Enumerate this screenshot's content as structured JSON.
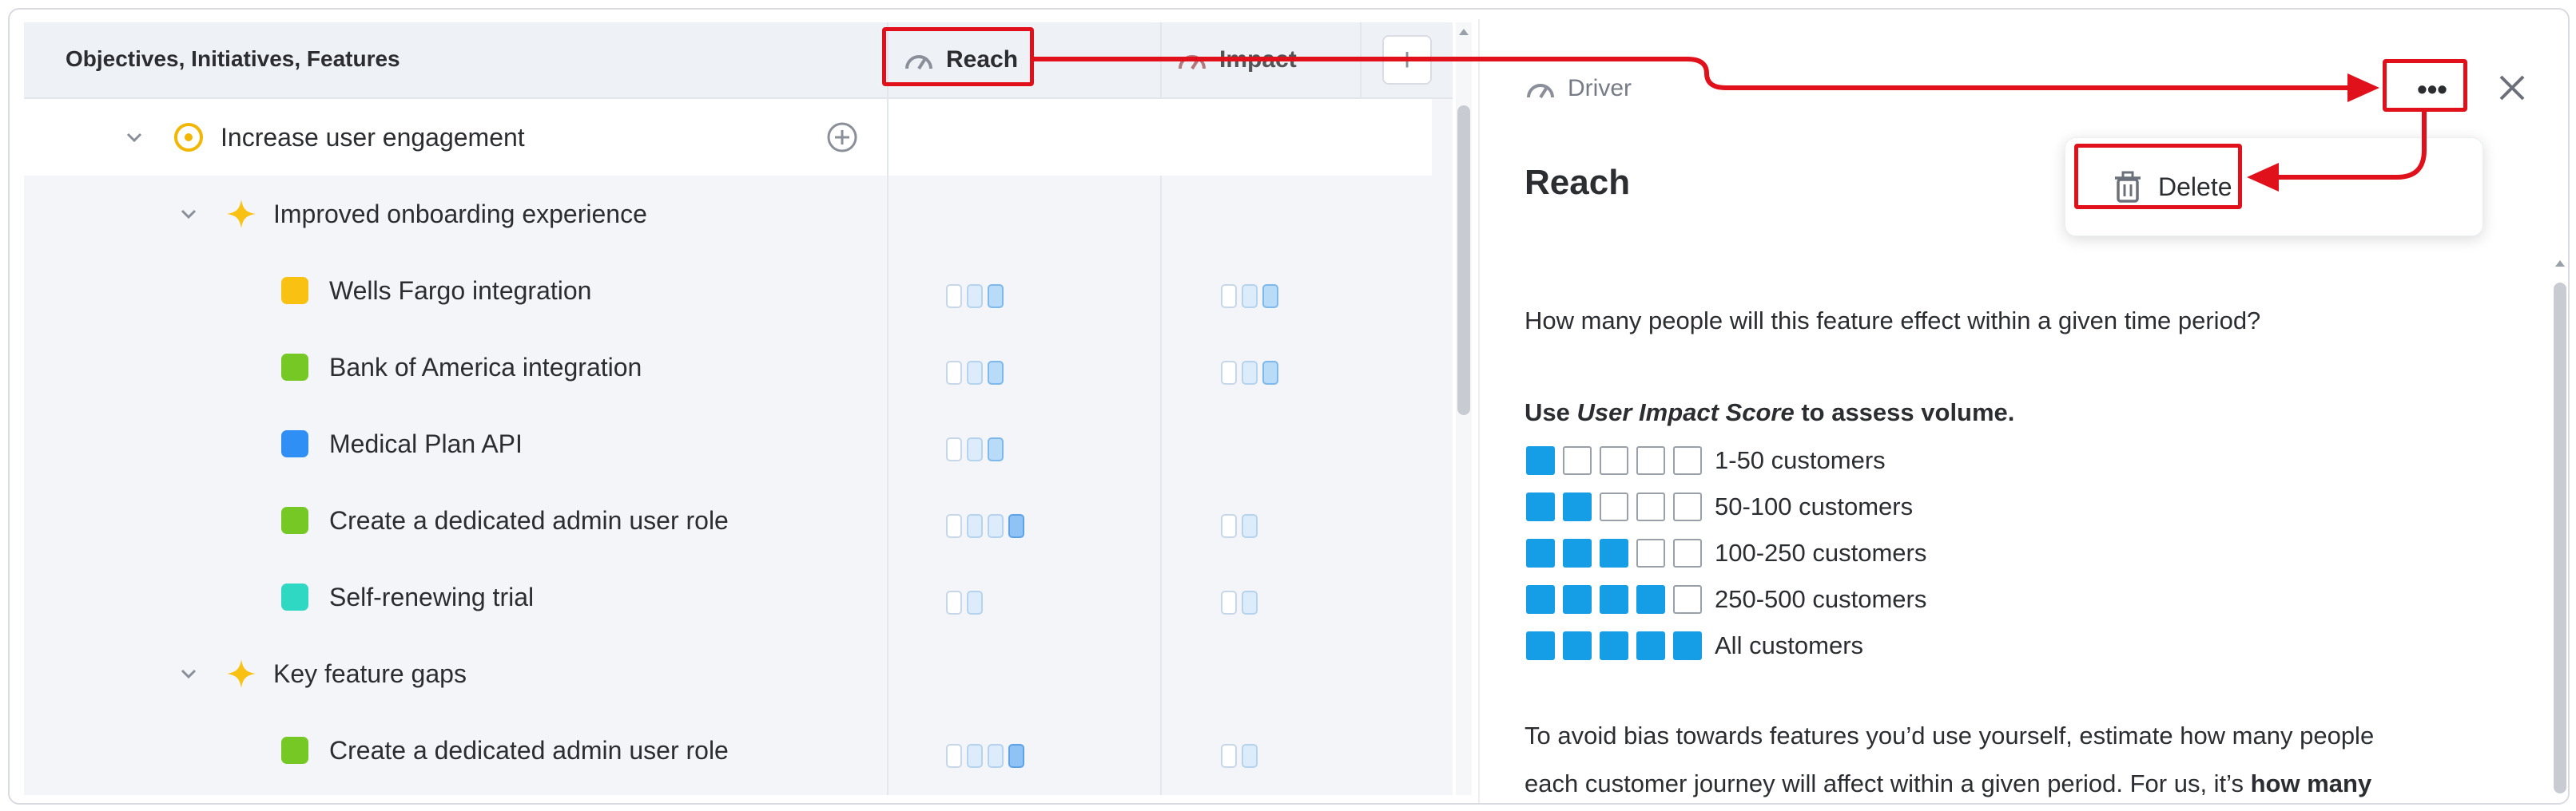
{
  "grid": {
    "header_title": "Objectives, Initiatives, Features",
    "columns": [
      {
        "label": "Reach",
        "icon": "gauge-icon"
      },
      {
        "label": "Impact",
        "icon": "gauge-icon"
      }
    ],
    "add_column_label": "+",
    "rows": [
      {
        "label": "Increase user engagement",
        "type": "objective"
      },
      {
        "label": "Improved onboarding experience",
        "type": "initiative"
      },
      {
        "label": "Wells Fargo integration",
        "type": "feature",
        "color": "#f9c112"
      },
      {
        "label": "Bank of America integration",
        "type": "feature",
        "color": "#76c924"
      },
      {
        "label": "Medical Plan API",
        "type": "feature",
        "color": "#2f8ff5"
      },
      {
        "label": "Create a dedicated admin user role",
        "type": "feature",
        "color": "#76c924"
      },
      {
        "label": "Self-renewing trial",
        "type": "feature",
        "color": "#2ed8c3"
      },
      {
        "label": "Key feature gaps",
        "type": "initiative"
      },
      {
        "label": "Create a dedicated admin user role",
        "type": "feature",
        "color": "#76c924"
      }
    ]
  },
  "panel": {
    "driver_label": "Driver",
    "title": "Reach",
    "more_label": "•••",
    "menu": {
      "delete_label": "Delete"
    },
    "question": "How many people will this feature effect within a given time period?",
    "use_prefix": "Use ",
    "use_em": "User Impact Score",
    "use_suffix": " to assess volume.",
    "scores": [
      {
        "filled": 1,
        "label": "1-50 customers"
      },
      {
        "filled": 2,
        "label": "50-100 customers"
      },
      {
        "filled": 3,
        "label": "100-250 customers"
      },
      {
        "filled": 4,
        "label": "250-500 customers"
      },
      {
        "filled": 5,
        "label": "All customers"
      }
    ],
    "bias_line1": "To avoid bias towards features you’d use yourself, estimate how many people",
    "bias_line2_prefix": "each customer journey will affect within a given period. For us, it’s ",
    "bias_line2_bold": "how many"
  },
  "colors": {
    "annotation_red": "#e0111b",
    "score_blue": "#159ee6"
  }
}
